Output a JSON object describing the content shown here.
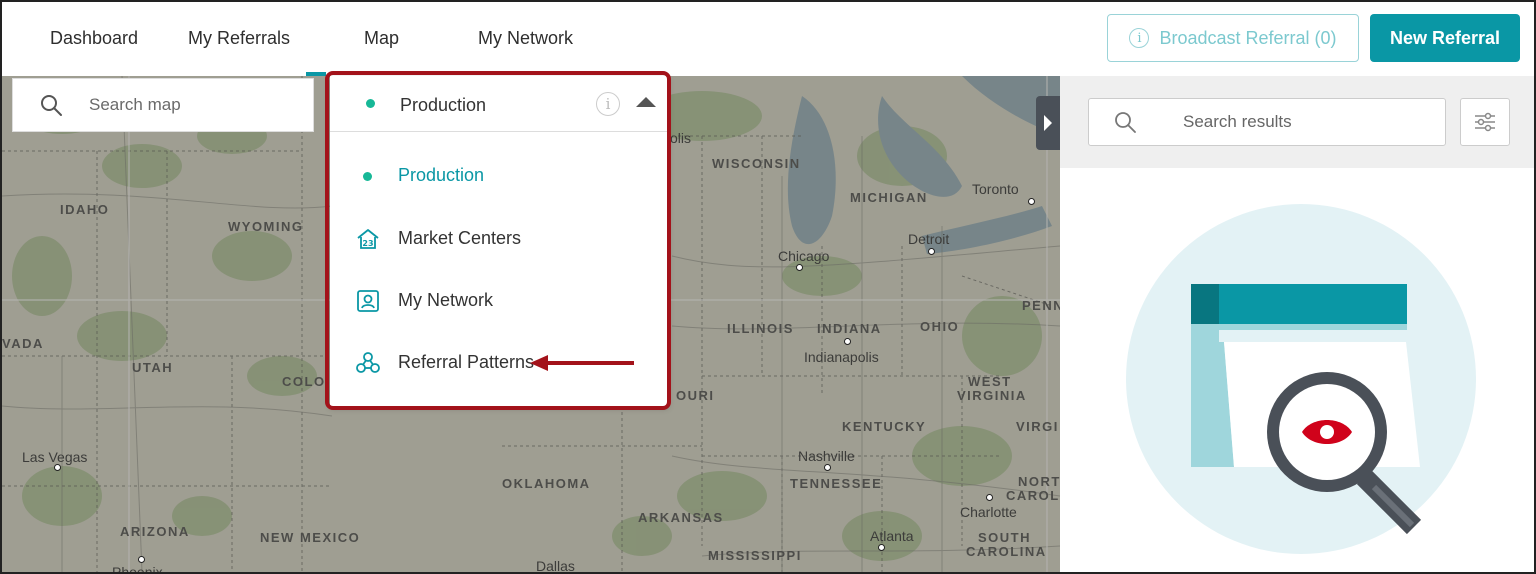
{
  "nav": {
    "items": [
      {
        "label": "Dashboard"
      },
      {
        "label": "My Referrals"
      },
      {
        "label": "Map"
      },
      {
        "label": "My Network"
      }
    ],
    "active": "Map"
  },
  "actions": {
    "broadcast_label": "Broadcast Referral (0)",
    "new_referral_label": "New Referral"
  },
  "map": {
    "search_placeholder": "Search map",
    "state_labels": [
      "IDAHO",
      "WYOMING",
      "WISCONSIN",
      "MICHIGAN",
      "VADA",
      "UTAH",
      "COLO",
      "ILLINOIS",
      "INDIANA",
      "OHIO",
      "PENN",
      "WEST",
      "VIRGINIA",
      "KENTUCKY",
      "VIRGI",
      "OURI",
      "OKLAHOMA",
      "TENNESSEE",
      "NORT",
      "CAROL",
      "ARIZONA",
      "NEW MEXICO",
      "ARKANSAS",
      "SOUTH",
      "CAROLINA",
      "MISSISSIPPI",
      "olis"
    ],
    "cities": [
      "Toronto",
      "Detroit",
      "Chicago",
      "Indianapolis",
      "Las Vegas",
      "Nashville",
      "Charlotte",
      "Atlanta",
      "Phoenix",
      "Dallas"
    ]
  },
  "layer_dropdown": {
    "selected": "Production",
    "options": [
      {
        "label": "Production",
        "icon": "green-dot-icon"
      },
      {
        "label": "Market Centers",
        "icon": "market-center-icon"
      },
      {
        "label": "My Network",
        "icon": "contact-card-icon"
      },
      {
        "label": "Referral Patterns",
        "icon": "network-nodes-icon"
      }
    ]
  },
  "results_panel": {
    "search_placeholder": "Search results"
  },
  "colors": {
    "accent": "#0a97a5",
    "status_green": "#17b897",
    "annotation_red": "#a3121a",
    "illustration_eye": "#d0021b"
  }
}
